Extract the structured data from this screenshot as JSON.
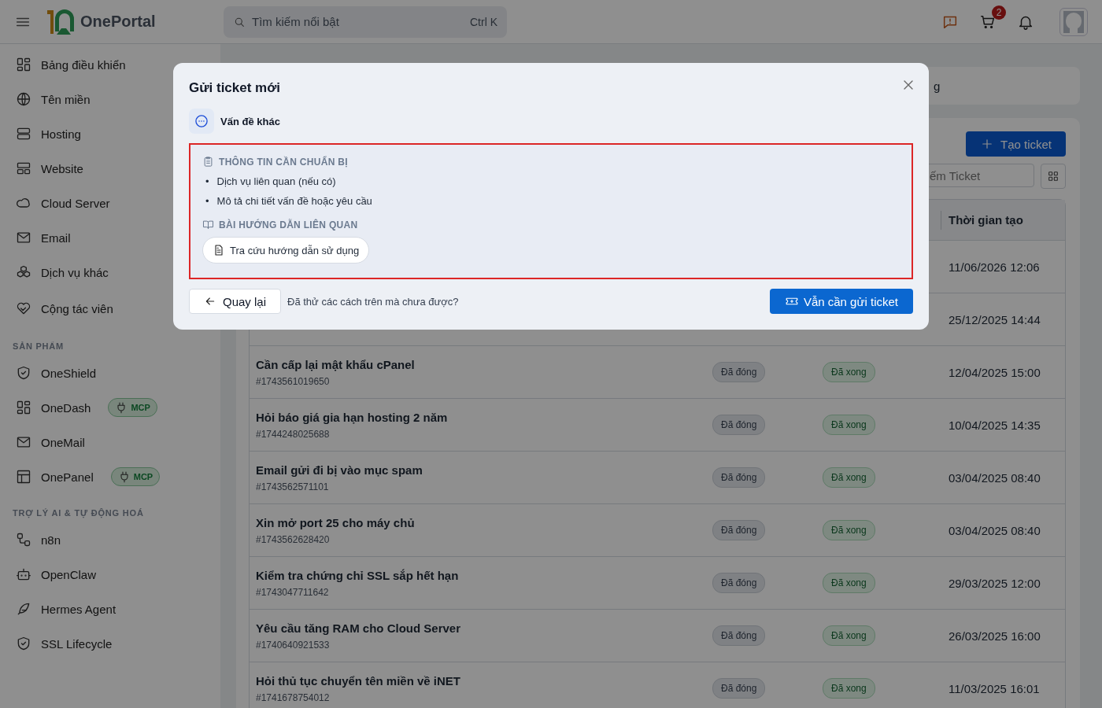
{
  "header": {
    "brand": "OnePortal",
    "search": {
      "placeholder": "Tìm kiếm nổi bật",
      "shortcut": "Ctrl K"
    },
    "cart_count": "2"
  },
  "sidebar": {
    "items": [
      {
        "label": "Bảng điều khiển"
      },
      {
        "label": "Tên miền"
      },
      {
        "label": "Hosting"
      },
      {
        "label": "Website"
      },
      {
        "label": "Cloud Server"
      },
      {
        "label": "Email"
      },
      {
        "label": "Dịch vụ khác"
      },
      {
        "label": "Cộng tác viên"
      }
    ],
    "sections": [
      {
        "title": "SẢN PHẨM",
        "items": [
          {
            "label": "OneShield"
          },
          {
            "label": "OneDash",
            "badge": "MCP"
          },
          {
            "label": "OneMail"
          },
          {
            "label": "OnePanel",
            "badge": "MCP"
          }
        ]
      },
      {
        "title": "TRỢ LÝ AI & TỰ ĐỘNG HOÁ",
        "items": [
          {
            "label": "n8n"
          },
          {
            "label": "OpenClaw"
          },
          {
            "label": "Hermes Agent"
          },
          {
            "label": "SSL Lifecycle"
          }
        ]
      }
    ]
  },
  "breadcrumb": {
    "text": "g"
  },
  "toolbar": {
    "create_button": "Tạo ticket",
    "search_placeholder": "ếm Ticket"
  },
  "table": {
    "columns": [
      "Thời gian tạo"
    ],
    "rows": [
      {
        "created": "11/06/2026 12:06"
      },
      {
        "created": "25/12/2025 14:44"
      },
      {
        "title": "Cần cấp lại mật khẩu cPanel",
        "id": "#1743561019650",
        "status": "Đã đóng",
        "result": "Đã xong",
        "created": "12/04/2025 15:00"
      },
      {
        "title": "Hỏi báo giá gia hạn hosting 2 năm",
        "id": "#1744248025688",
        "status": "Đã đóng",
        "result": "Đã xong",
        "created": "10/04/2025 14:35"
      },
      {
        "title": "Email gửi đi bị vào mục spam",
        "id": "#1743562571101",
        "status": "Đã đóng",
        "result": "Đã xong",
        "created": "03/04/2025 08:40"
      },
      {
        "title": "Xin mở port 25 cho máy chủ",
        "id": "#1743562628420",
        "status": "Đã đóng",
        "result": "Đã xong",
        "created": "03/04/2025 08:40"
      },
      {
        "title": "Kiểm tra chứng chỉ SSL sắp hết hạn",
        "id": "#1743047711642",
        "status": "Đã đóng",
        "result": "Đã xong",
        "created": "29/03/2025 12:00"
      },
      {
        "title": "Yêu cầu tăng RAM cho Cloud Server",
        "id": "#1740640921533",
        "status": "Đã đóng",
        "result": "Đã xong",
        "created": "26/03/2025 16:00"
      },
      {
        "title": "Hỏi thủ tục chuyển tên miền về iNET",
        "id": "#1741678754012",
        "status": "Đã đóng",
        "result": "Đã xong",
        "created": "11/03/2025 16:01"
      }
    ]
  },
  "modal": {
    "title": "Gửi ticket mới",
    "category": "Vấn đề khác",
    "highlighted": true,
    "prepare": {
      "title": "THÔNG TIN CẦN CHUẨN BỊ",
      "items": [
        {
          "marker": "•",
          "text": "Dịch vụ liên quan (nếu có)"
        },
        {
          "marker": "•",
          "text": "Mô tả chi tiết vấn đề hoặc yêu cầu"
        }
      ]
    },
    "guides": {
      "title": "BÀI HƯỚNG DẪN LIÊN QUAN",
      "links": [
        "Tra cứu hướng dẫn sử dụng"
      ]
    },
    "back_button": "Quay lại",
    "hint": "Đã thử các cách trên mà chưa được?",
    "submit_button": "Vẫn cần gửi ticket"
  }
}
